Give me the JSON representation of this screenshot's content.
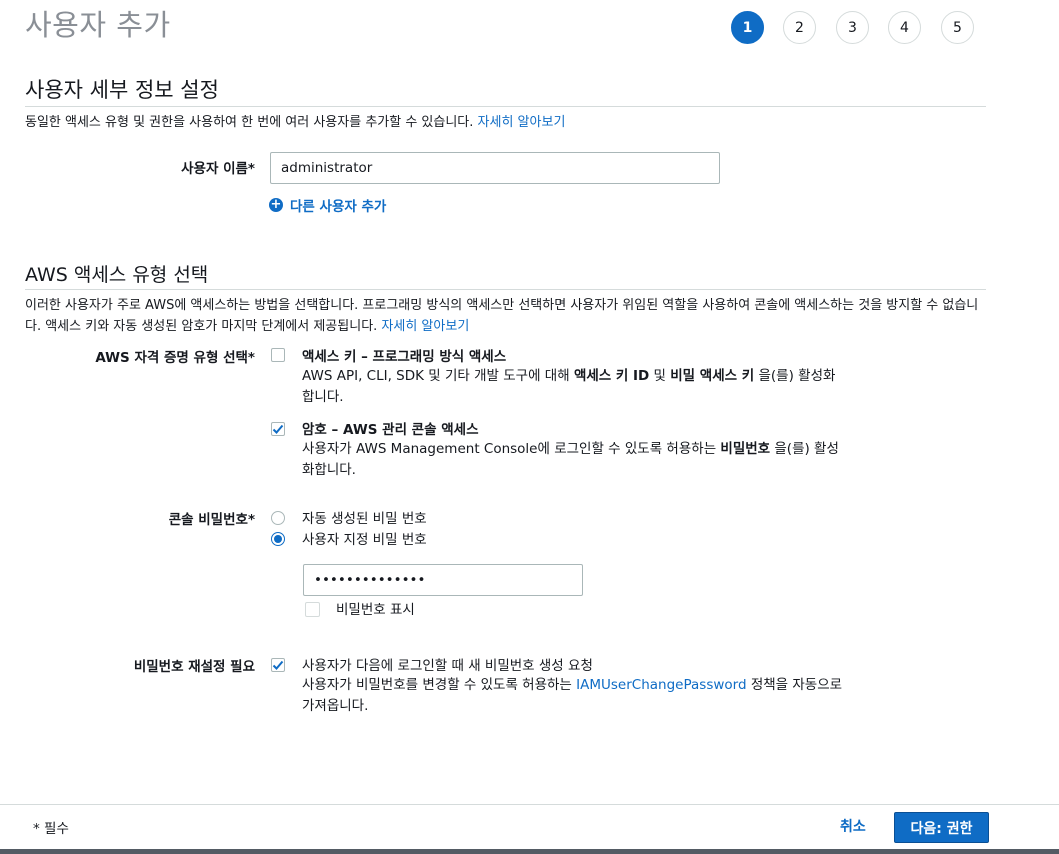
{
  "page": {
    "title": "사용자 추가"
  },
  "steps": [
    "1",
    "2",
    "3",
    "4",
    "5"
  ],
  "details": {
    "title": "사용자 세부 정보 설정",
    "description": "동일한 액세스 유형 및 권한을 사용하여 한 번에 여러 사용자를 추가할 수 있습니다. ",
    "learn_more": "자세히 알아보기",
    "username_label": "사용자 이름*",
    "username_value": "administrator",
    "add_user": "다른 사용자 추가"
  },
  "access": {
    "title": "AWS 액세스 유형 선택",
    "description": "이러한 사용자가 주로 AWS에 액세스하는 방법을 선택합니다. 프로그래밍 방식의 액세스만 선택하면 사용자가 위임된 역할을 사용하여 콘솔에 액세스하는 것을 방지할 수 없습니다. 액세스 키와 자동 생성된 암호가 마지막 단계에서 제공됩니다. ",
    "learn_more": "자세히 알아보기",
    "credential_label": "AWS 자격 증명 유형 선택*",
    "option1": {
      "title": "액세스 키 – 프로그래밍 방식 액세스",
      "desc_a": "AWS API, CLI, SDK 및 기타 개발 도구에 대해 ",
      "desc_b": "액세스 키 ID",
      "desc_c": " 및 ",
      "desc_d": "비밀 액세스 키",
      "desc_e": " 을(를) 활성화합니다.",
      "checked": false
    },
    "option2": {
      "title": "암호 – AWS 관리 콘솔 액세스",
      "desc_a": "사용자가 AWS Management Console에 로그인할 수 있도록 허용하는 ",
      "desc_b": "비밀번호",
      "desc_c": " 을(를) 활성화합니다.",
      "checked": true
    }
  },
  "console_password": {
    "label": "콘솔 비밀번호*",
    "auto": "자동 생성된 비밀 번호",
    "custom": "사용자 지정 비밀 번호",
    "selected": "custom",
    "value": "••••••••••••••",
    "show_label": "비밀번호 표시"
  },
  "reset": {
    "label": "비밀번호 재설정 필요",
    "text": "사용자가 다음에 로그인할 때 새 비밀번호 생성 요청",
    "desc_a": "사용자가 비밀번호를 변경할 수 있도록 허용하는 ",
    "policy_link": "IAMUserChangePassword",
    "desc_b": " 정책을 자동으로 가져옵니다.",
    "checked": true
  },
  "footer": {
    "required_note": "* 필수",
    "cancel": "취소",
    "next": "다음: 권한"
  },
  "colors": {
    "accent": "#0f6cc5",
    "title_gray": "#8a8f96",
    "border": "#aab7b8"
  }
}
